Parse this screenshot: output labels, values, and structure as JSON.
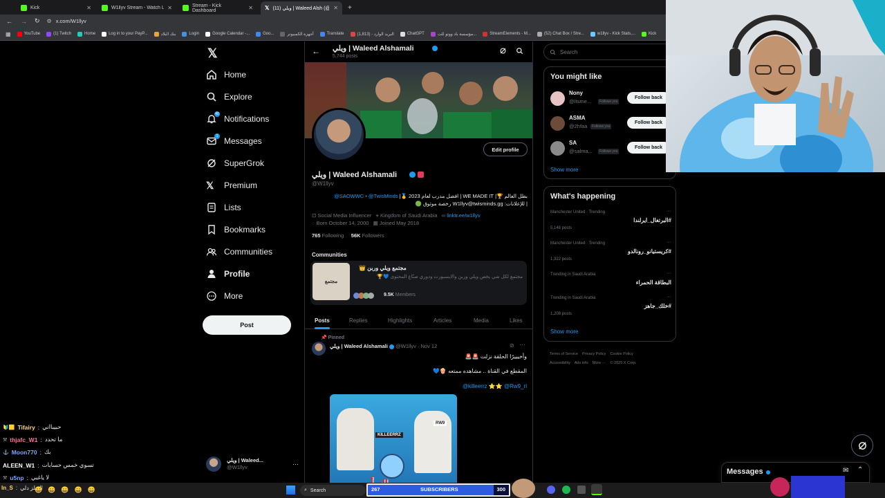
{
  "browser": {
    "tabs": [
      {
        "label": "Kick"
      },
      {
        "label": "W1llyv Stream - Watch Live on"
      },
      {
        "label": "Stream - Kick Dashboard"
      },
      {
        "label": "(11) ويلي | Waleed Alsh (@W1llyv) / X"
      }
    ],
    "url": "x.com/W1llyv",
    "bookmarks": [
      "YouTube",
      "(1) Twitch",
      "Home",
      "Log in to your PayP...",
      "بنك البلاد",
      "Login",
      "Google Calendar -...",
      "Goo...",
      "أجهزة الكمبيوتر",
      "Translate",
      "البريد الوارد - (1,813)",
      "ChatGPT",
      "مؤسسة باد ووتو للت...",
      "StreamElements - M...",
      "(52) Chat Box / Stre...",
      "w1llyv - Kick Stats,...",
      "Kick"
    ]
  },
  "left_nav": {
    "items": [
      {
        "label": "Home"
      },
      {
        "label": "Explore"
      },
      {
        "label": "Notifications",
        "badge": "40"
      },
      {
        "label": "Messages",
        "badge": "1"
      },
      {
        "label": "SuperGrok"
      },
      {
        "label": "Premium"
      },
      {
        "label": "Lists"
      },
      {
        "label": "Bookmarks"
      },
      {
        "label": "Communities"
      },
      {
        "label": "Profile"
      },
      {
        "label": "More"
      }
    ],
    "post_label": "Post",
    "account": {
      "name": "ويلي | Waleed...",
      "handle": "@W1llyv"
    }
  },
  "profile": {
    "header_name": "ويلي | Waleed Alshamali",
    "header_posts": "5,744 posts",
    "name": "ويلي | Waleed Alshamali",
    "handle": "@W1llyv",
    "edit_label": "Edit profile",
    "bio_line1": "بطل العالم 🏆| WE MADE IT | افضل مدرب لعام 2023 🥇|",
    "bio_mentions": "@SAOWWC • @TwisMinds",
    "bio_line2": "| للإعلانات: W1llyv@twisminds.gg رخصة موثوق 🟢",
    "category": "Social Media Influencer",
    "location": "Kingdom of Saudi Arabia",
    "website": "linktr.ee/w1llyv",
    "born": "Born October 14, 2000",
    "joined": "Joined May 2018",
    "following_count": "765",
    "following_label": "Following",
    "followers_count": "56K",
    "followers_label": "Followers",
    "communities_title": "Communities",
    "community": {
      "name": "مجتمع ويلي وربن 👑",
      "desc": "مجتمع لكل شي يخص ويلي وربن والايسبورت ودوري صنّاع المحتوى 💙🏆",
      "members_count": "9.5K",
      "members_label": "Members",
      "thumb_text": "مجتمع"
    },
    "tabs": [
      "Posts",
      "Replies",
      "Highlights",
      "Articles",
      "Media",
      "Likes"
    ],
    "active_tab": "Posts"
  },
  "pinned_post": {
    "pinned_label": "Pinned",
    "author": "ويلي | Waleed Alshamali",
    "handle": "@W1llyv",
    "date": "Nov 12",
    "line1": "وأخيييرًا الحلقة نزلت 🚨🚨",
    "line2": "المقطع في القناة .. مشاهده ممتعه 🍿💙",
    "mentions": "@killeerrz ⭐⭐ @Rw9_rl",
    "thumb_title": "مع التوأم",
    "thumb_label_left": "KILLEERRZ",
    "thumb_label_right": "RW9"
  },
  "right_col": {
    "search_placeholder": "Search",
    "suggest_title": "You might like",
    "suggestions": [
      {
        "name": "Nony",
        "handle": "@Itsme...",
        "follows_you": "Follows you",
        "button": "Follow back"
      },
      {
        "name": "ASMA",
        "handle": "@2hfaa",
        "follows_you": "Follows you",
        "button": "Follow back"
      },
      {
        "name": "SA",
        "handle": "@salma...",
        "follows_you": "Follows you",
        "button": "Follow back"
      }
    ],
    "show_more": "Show more",
    "happening_title": "What's happening",
    "trends": [
      {
        "meta": "Manchester United · Trending",
        "name": "#البرتغال_ايرلندا",
        "count": "5,148 posts"
      },
      {
        "meta": "Manchester United · Trending",
        "name": "#كريستيانو_رونالدو",
        "count": "1,322 posts"
      },
      {
        "meta": "Trending in Saudi Arabia",
        "name": "البطاقة الحمراء",
        "count": ""
      },
      {
        "meta": "Trending in Saudi Arabia",
        "name": "#خلك_جاهز",
        "count": "1,208 posts"
      }
    ],
    "trend_show_more": "Show more",
    "footer1": [
      "Terms of Service",
      "Privacy Policy",
      "Cookie Policy"
    ],
    "footer2": [
      "Accessibility",
      "Ads info",
      "More ···",
      "© 2025 X Corp."
    ]
  },
  "messages_drawer": {
    "label": "Messages"
  },
  "chat": [
    {
      "user": "Tifairy",
      "msg": "حبيبااني",
      "color": "#ffd86b"
    },
    {
      "user": "thjafc_W1",
      "msg": "ما تحدد",
      "color": "#ff6e9a"
    },
    {
      "user": "Moon770",
      "msg": "بك",
      "color": "#7aa7ff"
    },
    {
      "user": "ALEEN_W1",
      "msg": "تسوي خمس حسابات",
      "color": "#ffffff"
    },
    {
      "user": "u5np",
      "msg": "لا ياغبي",
      "color": "#7aa7ff"
    },
    {
      "user": "In_S",
      "msg": "الهيلز دلي",
      "color": "#ffd86b"
    }
  ],
  "taskbar": {
    "search_label": "Search"
  },
  "sub_goal": {
    "current": "267",
    "label": "SUBSCRIBERS",
    "goal": "300",
    "progress": 0.89
  },
  "colors": {
    "accent": "#1d9bf0",
    "kick_green": "#53fc18",
    "border": "#2f3336",
    "muted": "#71767b"
  }
}
